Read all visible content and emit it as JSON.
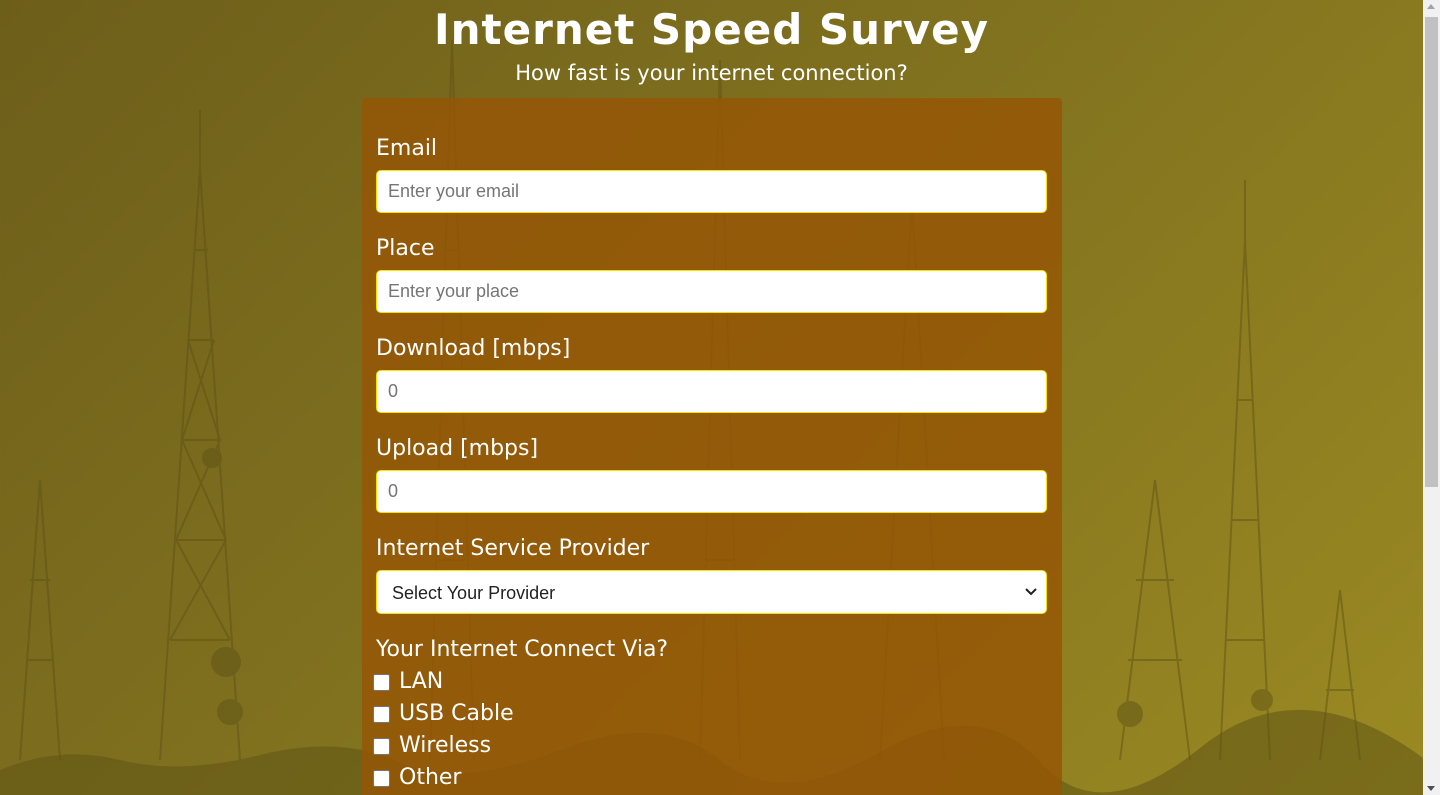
{
  "page": {
    "title": "Internet Speed Survey",
    "subtitle": "How fast is your internet connection?"
  },
  "form": {
    "email": {
      "label": "Email",
      "placeholder": "Enter your email",
      "value": ""
    },
    "place": {
      "label": "Place",
      "placeholder": "Enter your place",
      "value": ""
    },
    "download": {
      "label": "Download [mbps]",
      "placeholder": "0",
      "value": ""
    },
    "upload": {
      "label": "Upload [mbps]",
      "placeholder": "0",
      "value": ""
    },
    "provider": {
      "label": "Internet Service Provider",
      "selected": "Select Your Provider"
    },
    "connection": {
      "label": "Your Internet Connect Via?",
      "options": [
        {
          "label": "LAN",
          "checked": false
        },
        {
          "label": "USB Cable",
          "checked": false
        },
        {
          "label": "Wireless",
          "checked": false
        },
        {
          "label": "Other",
          "checked": false
        }
      ]
    }
  },
  "icons": {
    "select_chevron": "chevron-down-icon",
    "scroll_up": "scroll-up-arrow-icon",
    "scroll_down": "scroll-down-arrow-icon"
  },
  "colors": {
    "background": "#80711f",
    "form_panel": "#965505",
    "input_border": "#f5e400",
    "text": "#ffffff"
  }
}
